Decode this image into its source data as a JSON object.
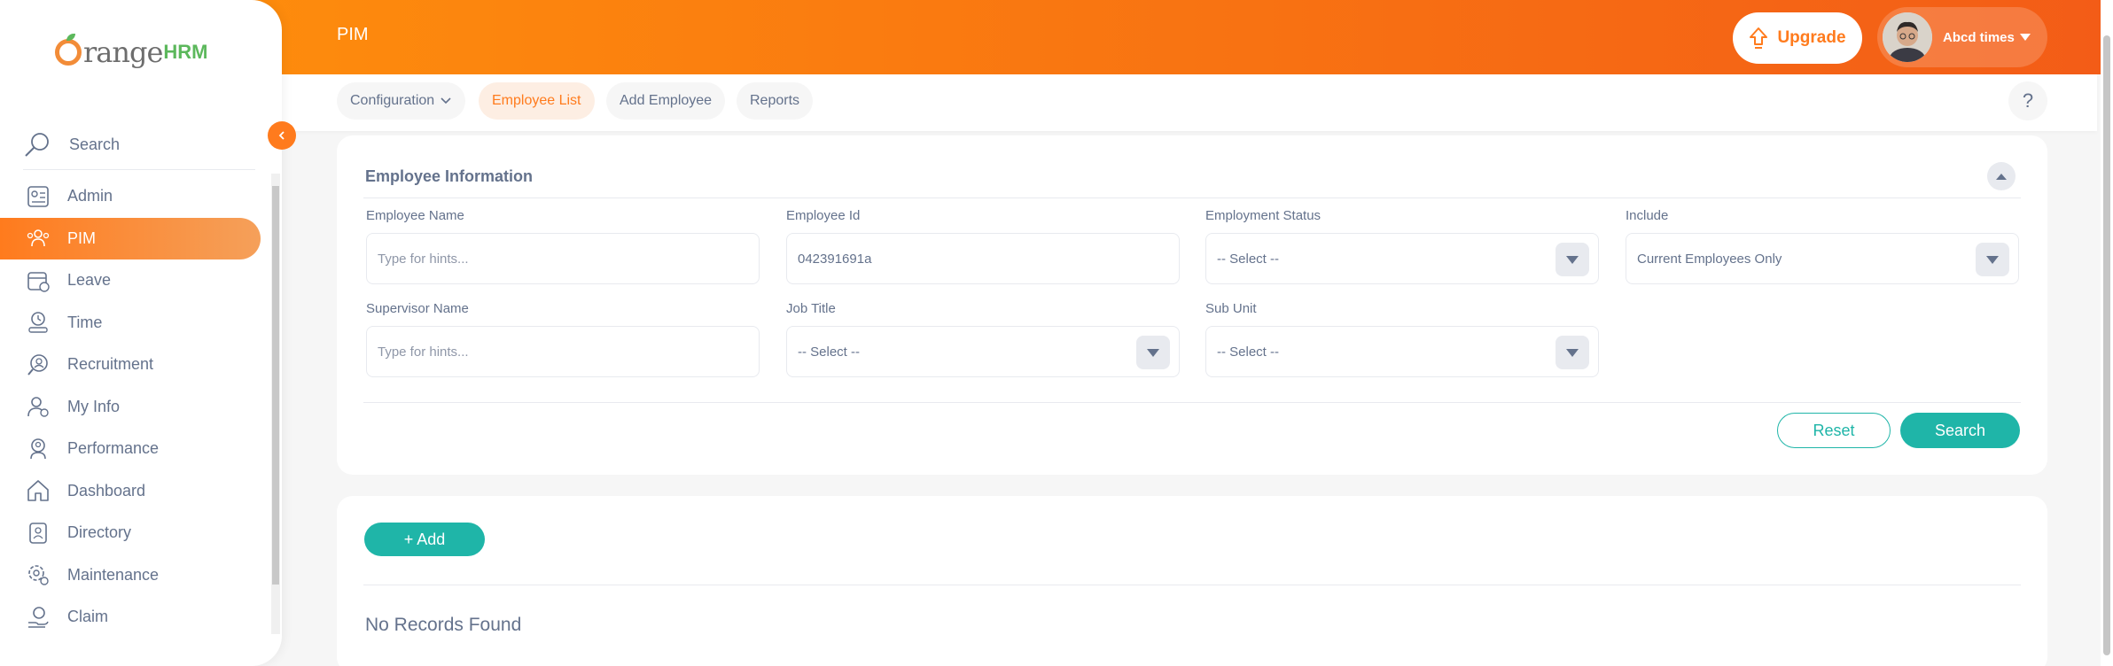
{
  "app": {
    "logo_text": "OrangeHRM"
  },
  "topbar": {
    "title": "PIM",
    "upgrade_label": "Upgrade",
    "user_name": "Abcd times"
  },
  "sidebar": {
    "search_placeholder": "Search",
    "items": [
      {
        "label": "Admin",
        "icon": "admin-icon"
      },
      {
        "label": "PIM",
        "icon": "pim-icon",
        "active": true
      },
      {
        "label": "Leave",
        "icon": "leave-icon"
      },
      {
        "label": "Time",
        "icon": "time-icon"
      },
      {
        "label": "Recruitment",
        "icon": "recruitment-icon"
      },
      {
        "label": "My Info",
        "icon": "my-info-icon"
      },
      {
        "label": "Performance",
        "icon": "performance-icon"
      },
      {
        "label": "Dashboard",
        "icon": "dashboard-icon"
      },
      {
        "label": "Directory",
        "icon": "directory-icon"
      },
      {
        "label": "Maintenance",
        "icon": "maintenance-icon"
      },
      {
        "label": "Claim",
        "icon": "claim-icon"
      }
    ]
  },
  "subnav": {
    "configuration": "Configuration",
    "employee_list": "Employee List",
    "add_employee": "Add Employee",
    "reports": "Reports",
    "help": "?"
  },
  "filter": {
    "title": "Employee Information",
    "employee_name": {
      "label": "Employee Name",
      "placeholder": "Type for hints...",
      "value": ""
    },
    "employee_id": {
      "label": "Employee Id",
      "value": "042391691a"
    },
    "employment_status": {
      "label": "Employment Status",
      "value": "-- Select --"
    },
    "include": {
      "label": "Include",
      "value": "Current Employees Only"
    },
    "supervisor_name": {
      "label": "Supervisor Name",
      "placeholder": "Type for hints...",
      "value": ""
    },
    "job_title": {
      "label": "Job Title",
      "value": "-- Select --"
    },
    "sub_unit": {
      "label": "Sub Unit",
      "value": "-- Select --"
    },
    "reset_label": "Reset",
    "search_label": "Search"
  },
  "list": {
    "add_label": "+ Add",
    "empty_text": "No Records Found"
  },
  "colors": {
    "brand_orange": "#ff7b1d",
    "accent_teal": "#1fb5a8",
    "text": "#64728c"
  }
}
